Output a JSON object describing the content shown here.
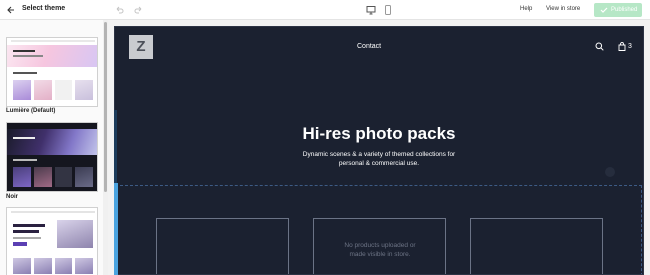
{
  "topbar": {
    "title": "Select theme",
    "help": "Help",
    "view_in_store": "View in store",
    "published": "Published"
  },
  "themes": [
    {
      "name": "Lumière (Default)"
    },
    {
      "name": "Noir"
    },
    {
      "name": ""
    }
  ],
  "preview": {
    "logo_letter": "Z",
    "nav_link": "Contact",
    "cart_count": "3",
    "hero_title": "Hi-res photo packs",
    "hero_subtitle": "Dynamic scenes & a variety of themed collections for personal & commercial use.",
    "empty_message": "No products uploaded or made visible in store."
  },
  "colors": {
    "accent": "#4aa3df",
    "published_bg": "#b6e7c6",
    "preview_bg": "#1b2130"
  },
  "icons": [
    "back-arrow-icon",
    "undo-icon",
    "redo-icon",
    "desktop-icon",
    "mobile-icon",
    "check-icon",
    "search-icon",
    "cart-icon"
  ]
}
